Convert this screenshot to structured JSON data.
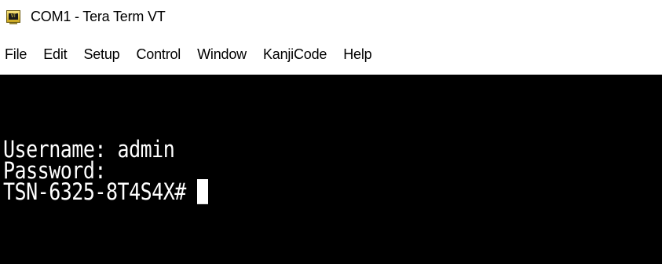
{
  "window": {
    "title": "COM1 - Tera Term VT",
    "icon": "teraterm-vt-icon",
    "icon_text": "VT"
  },
  "menu": {
    "items": [
      {
        "label": "File"
      },
      {
        "label": "Edit"
      },
      {
        "label": "Setup"
      },
      {
        "label": "Control"
      },
      {
        "label": "Window"
      },
      {
        "label": "KanjiCode"
      },
      {
        "label": "Help"
      }
    ]
  },
  "terminal": {
    "lines": [
      "Username: admin",
      "Password:",
      "TSN-6325-8T4S4X# "
    ],
    "background": "#000000",
    "foreground": "#ffffff"
  }
}
